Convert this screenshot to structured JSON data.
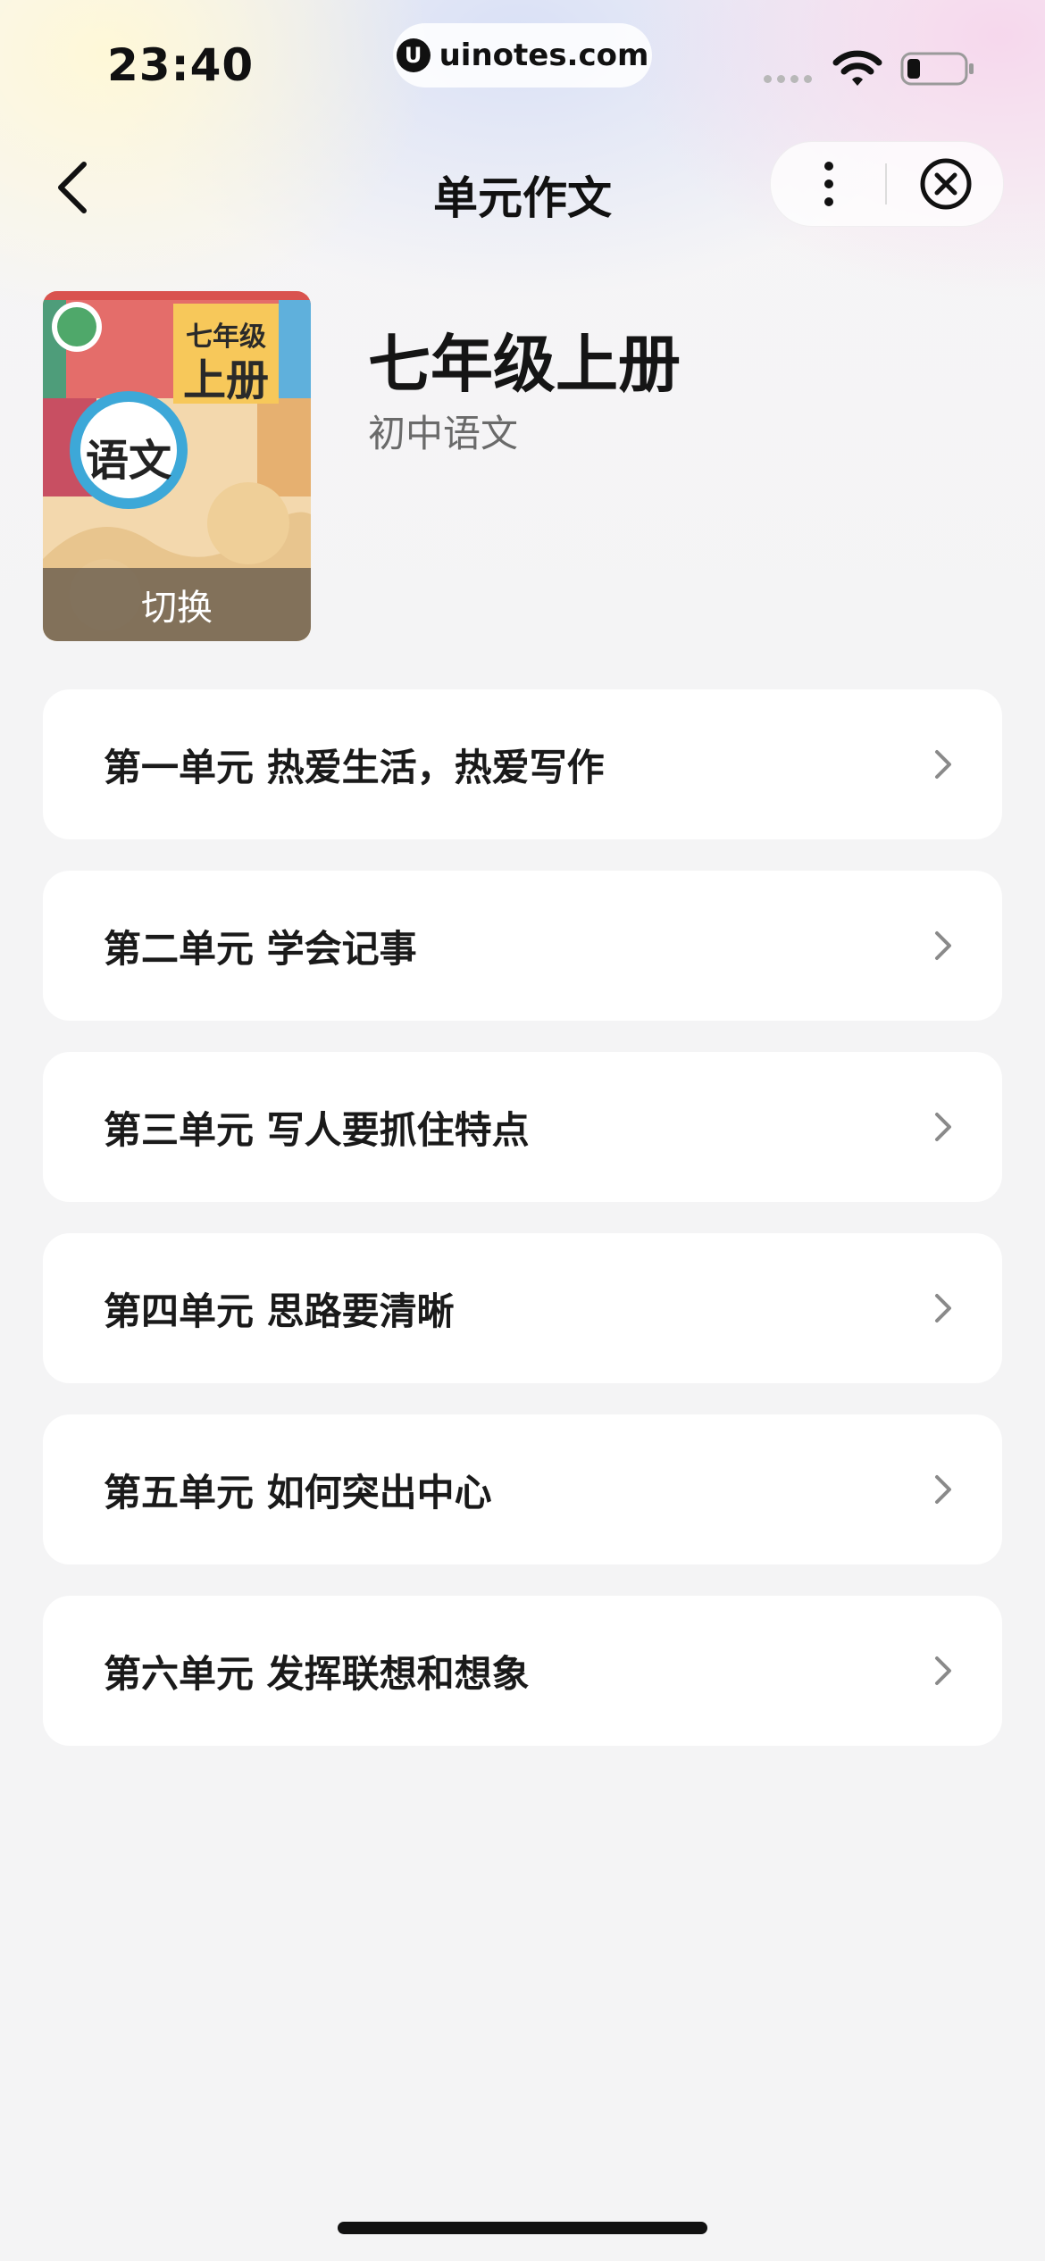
{
  "status_bar": {
    "time": "23:40",
    "url": "uinotes.com"
  },
  "nav": {
    "title": "单元作文",
    "back_icon": "chevron-left-icon",
    "more_icon": "more-vertical-icon",
    "close_icon": "close-circle-icon"
  },
  "book": {
    "cover_grade": "七年级",
    "cover_volume": "上册",
    "cover_subject": "语文",
    "switch_label": "切换",
    "title": "七年级上册",
    "subtitle": "初中语文"
  },
  "units": [
    {
      "label": "第一单元 热爱生活，热爱写作"
    },
    {
      "label": "第二单元 学会记事"
    },
    {
      "label": "第三单元 写人要抓住特点"
    },
    {
      "label": "第四单元 思路要清晰"
    },
    {
      "label": "第五单元 如何突出中心"
    },
    {
      "label": "第六单元 发挥联想和想象"
    }
  ],
  "colors": {
    "background": "#f4f4f5",
    "card": "#ffffff",
    "text_primary": "#1a1a1a",
    "text_secondary": "#6a6a6a"
  }
}
